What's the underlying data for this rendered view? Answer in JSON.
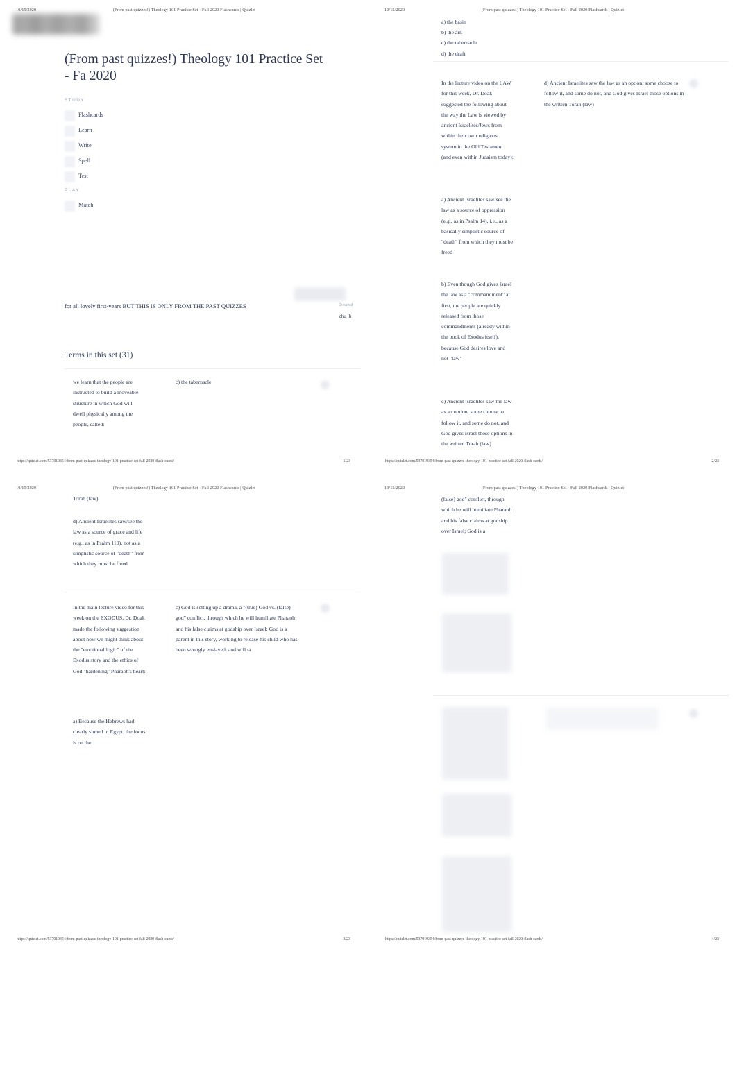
{
  "document": {
    "date": "10/15/2020",
    "running_title": "(From past quizzes!) Theology 101 Practice Set - Fall 2020 Flashcards | Quizlet",
    "url": "https://quizlet.com/537019354/from-past-quizzes-theology-101-practice-set-fall-2020-flash-cards/",
    "logo": "quizlet-logo"
  },
  "pages": [
    {
      "number": "1/23"
    },
    {
      "number": "2/23"
    },
    {
      "number": "3/23"
    },
    {
      "number": "4/23"
    }
  ],
  "set": {
    "title": "(From past quizzes!) Theology 101 Practice Set - Fa 2020",
    "description": "for all lovely first-years BUT THIS IS ONLY FROM THE PAST QUIZZES",
    "created_label": "Created",
    "created_by": "zhu_h",
    "terms_heading": "Terms in this set (31)"
  },
  "nav": {
    "study_heading": "STUDY",
    "study_items": [
      {
        "label": "Flashcards",
        "icon": "flashcards-icon"
      },
      {
        "label": "Learn",
        "icon": "learn-icon"
      },
      {
        "label": "Write",
        "icon": "write-icon"
      },
      {
        "label": "Spell",
        "icon": "spell-icon"
      },
      {
        "label": "Test",
        "icon": "test-icon"
      }
    ],
    "play_heading": "PLAY",
    "play_items": [
      {
        "label": "Match",
        "icon": "match-icon"
      }
    ]
  },
  "cards": {
    "card1": {
      "term": "we learn that the people are instructed to build a moveable structure in which God will dwell physically among the people, called:",
      "definition": "c) the tabernacle",
      "definition_continued": "a) the basin\nb) the ark\nc) the tabernacle\nd) the draft"
    },
    "card2": {
      "term": "In the lecture video on the LAW for this week, Dr. Doak suggested the following about the way the Law is viewed by ancient Israelites/Jews from within their own religious system in the Old Testament (and even within Judaism today):",
      "term_options_a": "a) Ancient Israelites saw/see the law as a source of oppression (e.g., as in Psalm 14), i.e., as a basically simplistic source of \"death\" from which they must be freed",
      "term_options_b": "b) Even though God gives Israel the law as a \"commandment\" at first, the people are quickly released from those commandments (already within the book of Exodus itself), because God desires love and not \"law\"",
      "term_options_c": "c) Ancient Israelites saw the law as an option; some choose to follow it, and some do not, and God gives Israel those options in the written Torah (law)",
      "term_options_d": "d) Ancient Israelites saw/see the law as a source of grace and life (e.g., as in Psalm 119), not as a simplistic source of \"death\" from which they must be freed",
      "definition": "d) Ancient Israelites saw the law as an option; some choose to follow it, and some do not, and God gives Israel those options in the written Torah (law)"
    },
    "card3": {
      "term": "In the main lecture video for this week on the EXODUS, Dr. Doak made the following suggestion about how we might think about the \"emotional logic\" of the Exodus story and the ethics of God \"hardening\" Pharaoh's heart:",
      "term_option_a": "a) Because the Hebrews had clearly sinned in Egypt, the focus is on the",
      "definition": "c) God is setting up a drama, a \"(true) God vs. (false) god\" conflict, through which he will humiliate Pharaoh and his false claims at godship over Israel; God is a parent in this story, working to release his child who has been wrongly enslaved, and will ta",
      "definition_continued": "(false) god\" conflict, through which he will humiliate Pharaoh and his false claims at godship over Israel; God is a"
    }
  }
}
